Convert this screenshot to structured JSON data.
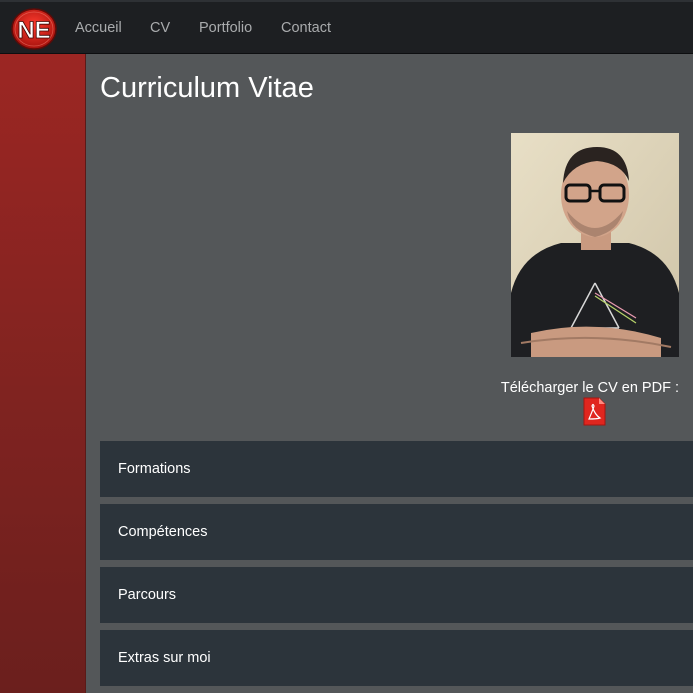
{
  "nav": {
    "logo_text": "NE",
    "items": [
      {
        "label": "Accueil"
      },
      {
        "label": "CV"
      },
      {
        "label": "Portfolio"
      },
      {
        "label": "Contact"
      }
    ]
  },
  "page": {
    "title": "Curriculum Vitae"
  },
  "download": {
    "label": "Télécharger le CV en PDF :",
    "icon": "pdf-icon"
  },
  "sections": [
    {
      "label": "Formations"
    },
    {
      "label": "Compétences"
    },
    {
      "label": "Parcours"
    },
    {
      "label": "Extras sur moi"
    }
  ],
  "colors": {
    "navbar": "#1d1f22",
    "sidebar": "#8a2422",
    "background": "#545759",
    "section": "#2c343b",
    "accent": "#e0261f"
  }
}
